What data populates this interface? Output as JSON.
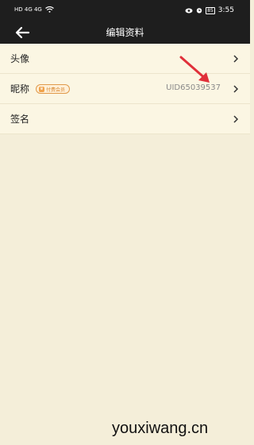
{
  "status_bar": {
    "left_info": "HD 4G 4G",
    "battery": "85",
    "time": "3:55"
  },
  "navbar": {
    "title": "编辑资料",
    "back_icon": "back-arrow-icon"
  },
  "rows": [
    {
      "label": "头像"
    },
    {
      "label": "昵称",
      "badge": "付费会员",
      "value": "UID65039537"
    },
    {
      "label": "签名"
    }
  ],
  "annotation": {
    "color": "#e0303a"
  },
  "watermark": "youxiwang.cn"
}
